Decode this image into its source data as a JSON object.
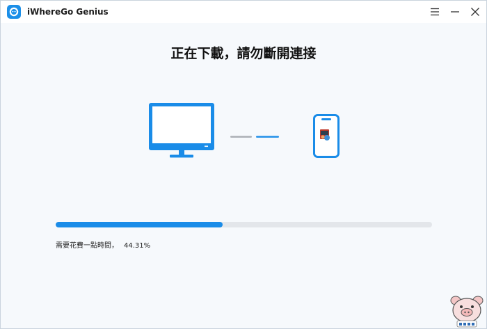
{
  "window": {
    "title": "iWhereGo Genius",
    "controls": [
      "menu-icon",
      "minimize-icon",
      "close-icon"
    ]
  },
  "main": {
    "heading": "正在下載，請勿斷開連接",
    "illustration": {
      "left_device": "monitor-icon",
      "right_device": "phone-icon",
      "connector": "transfer-line"
    },
    "progress": {
      "value_percent": 44.31,
      "status_label": "需要花費一點時間，",
      "percent_text": "44.31%"
    }
  },
  "colors": {
    "accent": "#1a8ce8",
    "track": "#e3e6ea",
    "background": "#f6f9fc",
    "titlebar": "#ffffff",
    "heading_text": "#111111"
  },
  "watermark": {
    "icon": "pig-mascot-icon"
  }
}
